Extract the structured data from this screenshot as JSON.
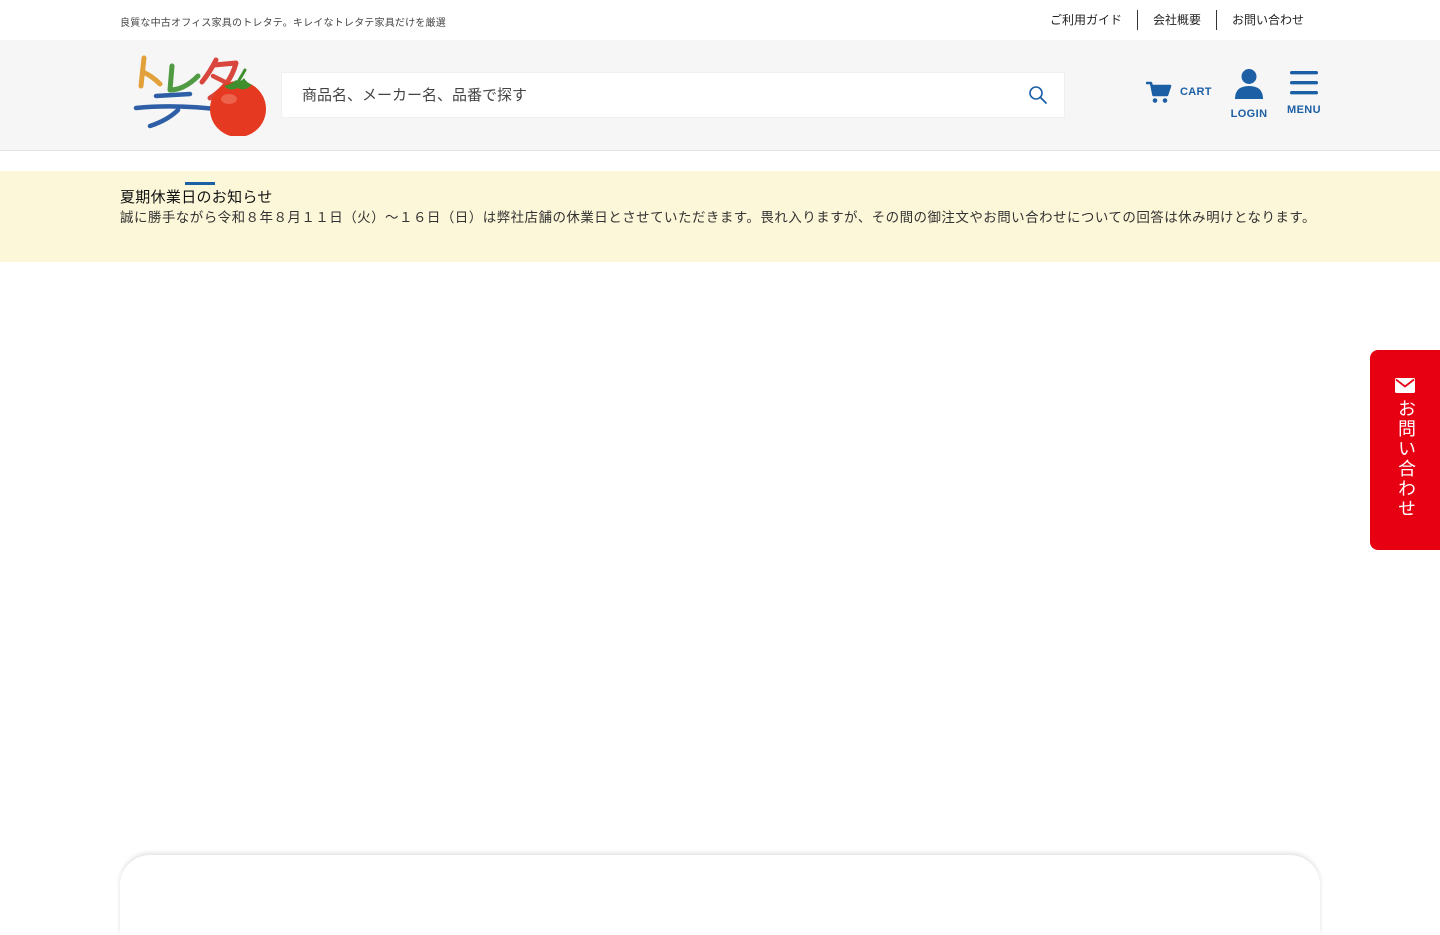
{
  "topbar": {
    "tagline": "良質な中古オフィス家具のトレタテ。キレイなトレタテ家具だけを厳選",
    "links": [
      {
        "label": "ご利用ガイド"
      },
      {
        "label": "会社概要"
      },
      {
        "label": "お問い合わせ"
      }
    ]
  },
  "header": {
    "logo_text": "トレタテ",
    "search": {
      "placeholder": "商品名、メーカー名、品番で探す",
      "icon": "search-icon"
    },
    "cart_label": "CART",
    "login_label": "LOGIN",
    "menu_label": "MENU",
    "accent_color": "#1c5fa5"
  },
  "notice": {
    "title": "夏期休業日のお知らせ",
    "body": "誠に勝手ながら令和８年８月１１日（火）〜１６日（日）は弊社店舗の休業日とさせていただきます。畏れ入りますが、その間の御注文やお問い合わせについての回答は休み明けとなります。",
    "background": "#fdf7d9"
  },
  "contact_tab": {
    "label": "お問い合わせ",
    "icon": "mail-icon",
    "color": "#e60012"
  }
}
